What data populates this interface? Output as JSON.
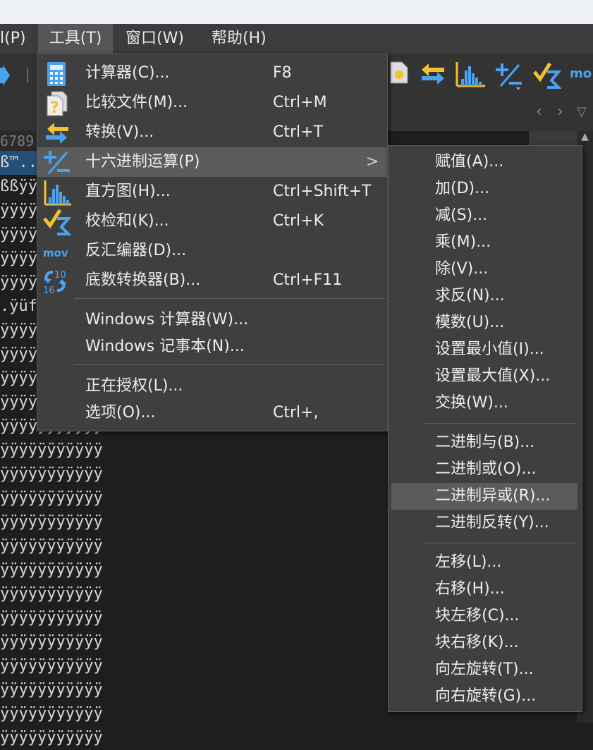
{
  "menubar": {
    "items": [
      {
        "label": "l(P)"
      },
      {
        "label": "工具(T)"
      },
      {
        "label": "窗口(W)"
      },
      {
        "label": "帮助(H)"
      }
    ]
  },
  "toolbar": {
    "right_text": "mo"
  },
  "editor": {
    "ruler": "6789",
    "rows": [
      "ß™..",
      "ßßÿÿ",
      "ÿÿÿÿ",
      "ÿÿÿÿ",
      "ÿÿÿÿ",
      "ÿÿÿÿ",
      ".ÿüf",
      "ÿÿÿÿ",
      "ÿÿÿÿ",
      "ÿÿÿÿ",
      "ÿÿÿÿ",
      "ÿÿÿÿÿÿÿÿÿÿÿ",
      "ÿÿÿÿÿÿÿÿÿÿÿ",
      "ÿÿÿÿÿÿÿÿÿÿÿ",
      "ÿÿÿÿÿÿÿÿÿÿÿ",
      "ÿÿÿÿÿÿÿÿÿÿÿ",
      "ÿÿÿÿÿÿÿÿÿÿÿ",
      "ÿÿÿÿÿÿÿÿÿÿÿ",
      "ÿÿÿÿÿÿÿÿÿÿÿ",
      "ÿÿÿÿÿÿÿÿÿÿÿ",
      "ÿÿÿÿÿÿÿÿÿÿÿ",
      "ÿÿÿÿÿÿÿÿÿÿÿ",
      "ÿÿÿÿÿÿÿÿÿÿÿ",
      "ÿÿÿÿÿÿÿÿÿÿÿ",
      "ÿÿÿÿÿÿÿÿÿÿÿ"
    ]
  },
  "tools_menu": {
    "items": [
      {
        "label": "计算器(C)...",
        "shortcut": "F8",
        "icon": "calculator-icon"
      },
      {
        "label": "比较文件(M)...",
        "shortcut": "Ctrl+M",
        "icon": "compare-files-icon"
      },
      {
        "label": "转换(V)...",
        "shortcut": "Ctrl+T",
        "icon": "convert-icon"
      },
      {
        "label": "十六进制运算(P)",
        "shortcut": "",
        "icon": "hex-operations-icon",
        "has_submenu": true
      },
      {
        "label": "直方图(H)...",
        "shortcut": "Ctrl+Shift+T",
        "icon": "histogram-icon"
      },
      {
        "label": "校检和(K)...",
        "shortcut": "Ctrl+K",
        "icon": "checksum-icon"
      },
      {
        "label": "反汇编器(D)...",
        "shortcut": "",
        "icon": "disassembler-icon",
        "icon_text": "mov"
      },
      {
        "label": "底数转换器(B)...",
        "shortcut": "Ctrl+F11",
        "icon": "base-converter-icon",
        "icon_text_a": "10",
        "icon_text_b": "16"
      },
      {
        "label": "Windows 计算器(W)...",
        "shortcut": ""
      },
      {
        "label": "Windows 记事本(N)...",
        "shortcut": ""
      },
      {
        "label": "正在授权(L)...",
        "shortcut": ""
      },
      {
        "label": "选项(O)...",
        "shortcut": "Ctrl+,"
      }
    ],
    "submenu_arrow": ">"
  },
  "hex_submenu": {
    "items": [
      "赋值(A)...",
      "加(D)...",
      "减(S)...",
      "乘(M)...",
      "除(V)...",
      "求反(N)...",
      "模数(U)...",
      "设置最小值(I)...",
      "设置最大值(X)...",
      "交换(W)...",
      "二进制与(B)...",
      "二进制或(O)...",
      "二进制异或(R)...",
      "二进制反转(Y)...",
      "左移(L)...",
      "右移(H)...",
      "块左移(C)...",
      "块右移(K)...",
      "向左旋转(T)...",
      "向右旋转(G)..."
    ]
  },
  "colors": {
    "accent_blue": "#4aa3f0",
    "accent_yellow": "#f2c230",
    "highlight": "#5b5b5b",
    "selection": "#264f78"
  }
}
